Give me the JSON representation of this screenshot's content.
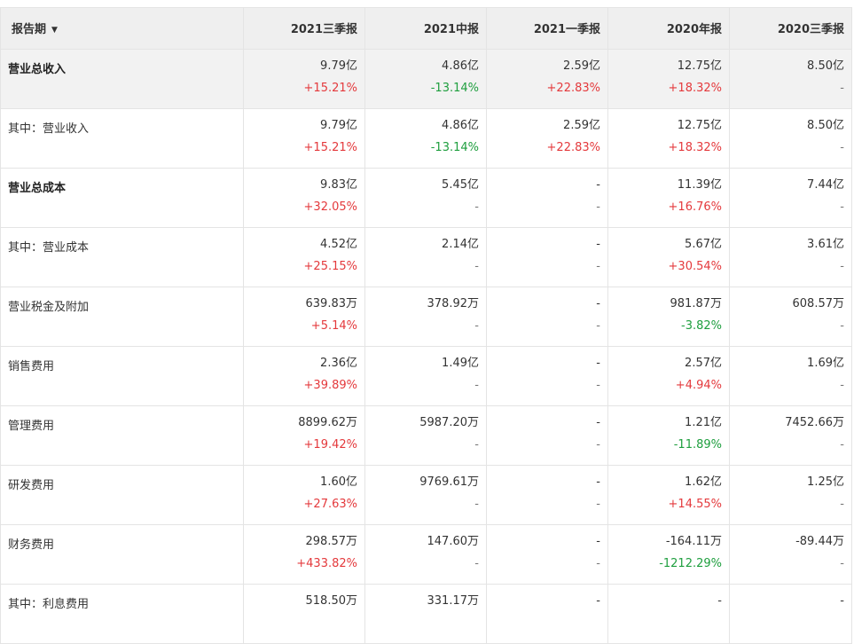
{
  "header": {
    "period_label": "报告期",
    "sort_icon": "caret-down-icon",
    "periods": [
      "2021三季报",
      "2021中报",
      "2021一季报",
      "2020年报",
      "2020三季报"
    ]
  },
  "colors": {
    "increase": "#e4393c",
    "decrease": "#1e9e3e",
    "header_bg": "#efefef",
    "highlight_row_bg": "#f2f2f2",
    "border": "#e4e4e4"
  },
  "rows": [
    {
      "label": "营业总收入",
      "bold": true,
      "shaded": true,
      "cells": [
        [
          "9.79亿",
          "+15.21%"
        ],
        [
          "4.86亿",
          "-13.14%"
        ],
        [
          "2.59亿",
          "+22.83%"
        ],
        [
          "12.75亿",
          "+18.32%"
        ],
        [
          "8.50亿",
          "-"
        ]
      ]
    },
    {
      "label": "其中：营业收入",
      "bold": false,
      "shaded": false,
      "cells": [
        [
          "9.79亿",
          "+15.21%"
        ],
        [
          "4.86亿",
          "-13.14%"
        ],
        [
          "2.59亿",
          "+22.83%"
        ],
        [
          "12.75亿",
          "+18.32%"
        ],
        [
          "8.50亿",
          "-"
        ]
      ]
    },
    {
      "label": "营业总成本",
      "bold": true,
      "shaded": false,
      "cells": [
        [
          "9.83亿",
          "+32.05%"
        ],
        [
          "5.45亿",
          "-"
        ],
        [
          "-",
          "-"
        ],
        [
          "11.39亿",
          "+16.76%"
        ],
        [
          "7.44亿",
          "-"
        ]
      ]
    },
    {
      "label": "其中：营业成本",
      "bold": false,
      "shaded": false,
      "cells": [
        [
          "4.52亿",
          "+25.15%"
        ],
        [
          "2.14亿",
          "-"
        ],
        [
          "-",
          "-"
        ],
        [
          "5.67亿",
          "+30.54%"
        ],
        [
          "3.61亿",
          "-"
        ]
      ]
    },
    {
      "label": "营业税金及附加",
      "bold": false,
      "shaded": false,
      "cells": [
        [
          "639.83万",
          "+5.14%"
        ],
        [
          "378.92万",
          "-"
        ],
        [
          "-",
          "-"
        ],
        [
          "981.87万",
          "-3.82%"
        ],
        [
          "608.57万",
          "-"
        ]
      ]
    },
    {
      "label": "销售费用",
      "bold": false,
      "shaded": false,
      "cells": [
        [
          "2.36亿",
          "+39.89%"
        ],
        [
          "1.49亿",
          "-"
        ],
        [
          "-",
          "-"
        ],
        [
          "2.57亿",
          "+4.94%"
        ],
        [
          "1.69亿",
          "-"
        ]
      ]
    },
    {
      "label": "管理费用",
      "bold": false,
      "shaded": false,
      "cells": [
        [
          "8899.62万",
          "+19.42%"
        ],
        [
          "5987.20万",
          "-"
        ],
        [
          "-",
          "-"
        ],
        [
          "1.21亿",
          "-11.89%"
        ],
        [
          "7452.66万",
          "-"
        ]
      ]
    },
    {
      "label": "研发费用",
      "bold": false,
      "shaded": false,
      "cells": [
        [
          "1.60亿",
          "+27.63%"
        ],
        [
          "9769.61万",
          "-"
        ],
        [
          "-",
          "-"
        ],
        [
          "1.62亿",
          "+14.55%"
        ],
        [
          "1.25亿",
          "-"
        ]
      ]
    },
    {
      "label": "财务费用",
      "bold": false,
      "shaded": false,
      "cells": [
        [
          "298.57万",
          "+433.82%"
        ],
        [
          "147.60万",
          "-"
        ],
        [
          "-",
          "-"
        ],
        [
          "-164.11万",
          "-1212.29%"
        ],
        [
          "-89.44万",
          "-"
        ]
      ]
    },
    {
      "label": "其中：利息费用",
      "bold": false,
      "shaded": false,
      "cells": [
        [
          "518.50万",
          ""
        ],
        [
          "331.17万",
          ""
        ],
        [
          "-",
          ""
        ],
        [
          "-",
          ""
        ],
        [
          "-",
          ""
        ]
      ]
    }
  ]
}
